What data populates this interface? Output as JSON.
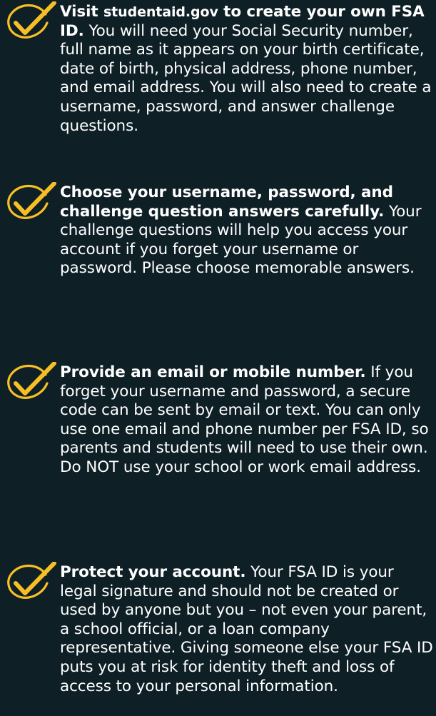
{
  "theme": {
    "background": "#0e1f26",
    "check_color": "#f7bf26",
    "text_color": "#ffffff"
  },
  "tips": [
    {
      "icon": "checkmark-icon",
      "heading_prefix": "Visit ",
      "heading_domain": "studentaid.gov",
      "heading_suffix": " to create your own FSA ID.",
      "body": "You will need your Social Security number, full name as it appears on your birth certificate, date of birth, physical address, phone number, and email address. You will also need to create a username, password, and answer challenge questions."
    },
    {
      "icon": "checkmark-icon",
      "heading": "Choose your username, password, and challenge question answers carefully.",
      "body": "Your challenge questions will help you access your account if you forget your username or password. Please choose memorable answers."
    },
    {
      "icon": "checkmark-icon",
      "heading": "Provide an email or mobile number.",
      "body": "If you forget your username and password, a secure code can be sent by email or text. You can only use one email and phone number per FSA ID, so parents and students will need to use their own. Do NOT use your school or work email address."
    },
    {
      "icon": "checkmark-icon",
      "heading": "Protect your account.",
      "body": "Your FSA ID is your legal signature and should not be created or used by anyone but you – not even your parent, a school official, or a loan company representative. Giving someone else your FSA ID puts you at risk for identity theft and loss of access to your personal information."
    }
  ]
}
